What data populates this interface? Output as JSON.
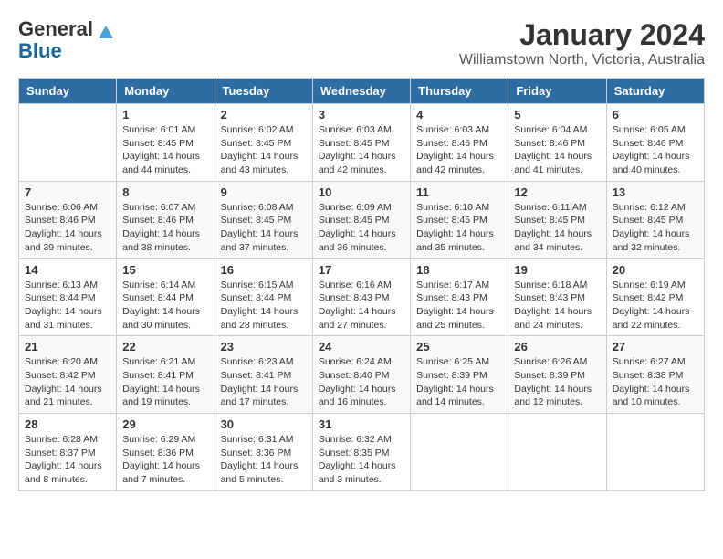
{
  "logo": {
    "general": "General",
    "blue": "Blue"
  },
  "title": "January 2024",
  "subtitle": "Williamstown North, Victoria, Australia",
  "days_of_week": [
    "Sunday",
    "Monday",
    "Tuesday",
    "Wednesday",
    "Thursday",
    "Friday",
    "Saturday"
  ],
  "weeks": [
    [
      {
        "day": "",
        "sunrise": "",
        "sunset": "",
        "daylight": ""
      },
      {
        "day": "1",
        "sunrise": "Sunrise: 6:01 AM",
        "sunset": "Sunset: 8:45 PM",
        "daylight": "Daylight: 14 hours and 44 minutes."
      },
      {
        "day": "2",
        "sunrise": "Sunrise: 6:02 AM",
        "sunset": "Sunset: 8:45 PM",
        "daylight": "Daylight: 14 hours and 43 minutes."
      },
      {
        "day": "3",
        "sunrise": "Sunrise: 6:03 AM",
        "sunset": "Sunset: 8:45 PM",
        "daylight": "Daylight: 14 hours and 42 minutes."
      },
      {
        "day": "4",
        "sunrise": "Sunrise: 6:03 AM",
        "sunset": "Sunset: 8:46 PM",
        "daylight": "Daylight: 14 hours and 42 minutes."
      },
      {
        "day": "5",
        "sunrise": "Sunrise: 6:04 AM",
        "sunset": "Sunset: 8:46 PM",
        "daylight": "Daylight: 14 hours and 41 minutes."
      },
      {
        "day": "6",
        "sunrise": "Sunrise: 6:05 AM",
        "sunset": "Sunset: 8:46 PM",
        "daylight": "Daylight: 14 hours and 40 minutes."
      }
    ],
    [
      {
        "day": "7",
        "sunrise": "Sunrise: 6:06 AM",
        "sunset": "Sunset: 8:46 PM",
        "daylight": "Daylight: 14 hours and 39 minutes."
      },
      {
        "day": "8",
        "sunrise": "Sunrise: 6:07 AM",
        "sunset": "Sunset: 8:46 PM",
        "daylight": "Daylight: 14 hours and 38 minutes."
      },
      {
        "day": "9",
        "sunrise": "Sunrise: 6:08 AM",
        "sunset": "Sunset: 8:45 PM",
        "daylight": "Daylight: 14 hours and 37 minutes."
      },
      {
        "day": "10",
        "sunrise": "Sunrise: 6:09 AM",
        "sunset": "Sunset: 8:45 PM",
        "daylight": "Daylight: 14 hours and 36 minutes."
      },
      {
        "day": "11",
        "sunrise": "Sunrise: 6:10 AM",
        "sunset": "Sunset: 8:45 PM",
        "daylight": "Daylight: 14 hours and 35 minutes."
      },
      {
        "day": "12",
        "sunrise": "Sunrise: 6:11 AM",
        "sunset": "Sunset: 8:45 PM",
        "daylight": "Daylight: 14 hours and 34 minutes."
      },
      {
        "day": "13",
        "sunrise": "Sunrise: 6:12 AM",
        "sunset": "Sunset: 8:45 PM",
        "daylight": "Daylight: 14 hours and 32 minutes."
      }
    ],
    [
      {
        "day": "14",
        "sunrise": "Sunrise: 6:13 AM",
        "sunset": "Sunset: 8:44 PM",
        "daylight": "Daylight: 14 hours and 31 minutes."
      },
      {
        "day": "15",
        "sunrise": "Sunrise: 6:14 AM",
        "sunset": "Sunset: 8:44 PM",
        "daylight": "Daylight: 14 hours and 30 minutes."
      },
      {
        "day": "16",
        "sunrise": "Sunrise: 6:15 AM",
        "sunset": "Sunset: 8:44 PM",
        "daylight": "Daylight: 14 hours and 28 minutes."
      },
      {
        "day": "17",
        "sunrise": "Sunrise: 6:16 AM",
        "sunset": "Sunset: 8:43 PM",
        "daylight": "Daylight: 14 hours and 27 minutes."
      },
      {
        "day": "18",
        "sunrise": "Sunrise: 6:17 AM",
        "sunset": "Sunset: 8:43 PM",
        "daylight": "Daylight: 14 hours and 25 minutes."
      },
      {
        "day": "19",
        "sunrise": "Sunrise: 6:18 AM",
        "sunset": "Sunset: 8:43 PM",
        "daylight": "Daylight: 14 hours and 24 minutes."
      },
      {
        "day": "20",
        "sunrise": "Sunrise: 6:19 AM",
        "sunset": "Sunset: 8:42 PM",
        "daylight": "Daylight: 14 hours and 22 minutes."
      }
    ],
    [
      {
        "day": "21",
        "sunrise": "Sunrise: 6:20 AM",
        "sunset": "Sunset: 8:42 PM",
        "daylight": "Daylight: 14 hours and 21 minutes."
      },
      {
        "day": "22",
        "sunrise": "Sunrise: 6:21 AM",
        "sunset": "Sunset: 8:41 PM",
        "daylight": "Daylight: 14 hours and 19 minutes."
      },
      {
        "day": "23",
        "sunrise": "Sunrise: 6:23 AM",
        "sunset": "Sunset: 8:41 PM",
        "daylight": "Daylight: 14 hours and 17 minutes."
      },
      {
        "day": "24",
        "sunrise": "Sunrise: 6:24 AM",
        "sunset": "Sunset: 8:40 PM",
        "daylight": "Daylight: 14 hours and 16 minutes."
      },
      {
        "day": "25",
        "sunrise": "Sunrise: 6:25 AM",
        "sunset": "Sunset: 8:39 PM",
        "daylight": "Daylight: 14 hours and 14 minutes."
      },
      {
        "day": "26",
        "sunrise": "Sunrise: 6:26 AM",
        "sunset": "Sunset: 8:39 PM",
        "daylight": "Daylight: 14 hours and 12 minutes."
      },
      {
        "day": "27",
        "sunrise": "Sunrise: 6:27 AM",
        "sunset": "Sunset: 8:38 PM",
        "daylight": "Daylight: 14 hours and 10 minutes."
      }
    ],
    [
      {
        "day": "28",
        "sunrise": "Sunrise: 6:28 AM",
        "sunset": "Sunset: 8:37 PM",
        "daylight": "Daylight: 14 hours and 8 minutes."
      },
      {
        "day": "29",
        "sunrise": "Sunrise: 6:29 AM",
        "sunset": "Sunset: 8:36 PM",
        "daylight": "Daylight: 14 hours and 7 minutes."
      },
      {
        "day": "30",
        "sunrise": "Sunrise: 6:31 AM",
        "sunset": "Sunset: 8:36 PM",
        "daylight": "Daylight: 14 hours and 5 minutes."
      },
      {
        "day": "31",
        "sunrise": "Sunrise: 6:32 AM",
        "sunset": "Sunset: 8:35 PM",
        "daylight": "Daylight: 14 hours and 3 minutes."
      },
      {
        "day": "",
        "sunrise": "",
        "sunset": "",
        "daylight": ""
      },
      {
        "day": "",
        "sunrise": "",
        "sunset": "",
        "daylight": ""
      },
      {
        "day": "",
        "sunrise": "",
        "sunset": "",
        "daylight": ""
      }
    ]
  ]
}
